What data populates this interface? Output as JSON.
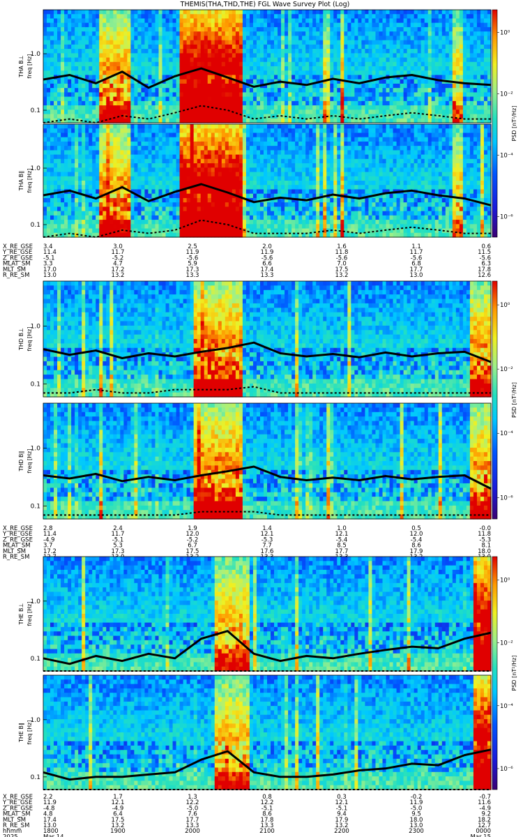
{
  "title": "THEMIS(THA,THD,THE) FGL Wave Survey Plot (Log)",
  "colors": {
    "colormap": [
      "#3a0072",
      "#1a1adb",
      "#0055ff",
      "#00c8ff",
      "#22e0c0",
      "#9cf08a",
      "#f0f020",
      "#ff9a00",
      "#e00000"
    ],
    "trace": "#000000"
  },
  "colorbar": {
    "label": "PSD [nT²/Hz]",
    "ticks": [
      "10⁰",
      "10⁻²",
      "10⁻⁴",
      "10⁻⁶"
    ]
  },
  "freq_ticks": [
    "1.0",
    "0.1"
  ],
  "eph_labels": [
    "X_RE_GSE",
    "Y_RE_GSE",
    "Z_RE_GSE",
    "MLAT_SM",
    "MLT_SM",
    "R_RE_SM"
  ],
  "time_row_labels": [
    "hhmm",
    "2025"
  ],
  "chart_data": [
    {
      "type": "heatmap",
      "probe": "THA",
      "panels": [
        {
          "ylabel": "THA B⊥",
          "unit": "freq [Hz]",
          "traces": {
            "f_peak": [
              0.35,
              0.42,
              0.3,
              0.48,
              0.25,
              0.4,
              0.55,
              0.38,
              0.26,
              0.32,
              0.28,
              0.36,
              0.3,
              0.38,
              0.42,
              0.34,
              0.3,
              0.28
            ],
            "f_low": [
              0.06,
              0.07,
              0.06,
              0.08,
              0.07,
              0.09,
              0.12,
              0.1,
              0.07,
              0.08,
              0.07,
              0.08,
              0.07,
              0.08,
              0.09,
              0.08,
              0.07,
              0.07
            ]
          }
        },
        {
          "ylabel": "THA B∥",
          "unit": "freq [Hz]",
          "traces": {
            "f_peak": [
              0.33,
              0.4,
              0.29,
              0.46,
              0.26,
              0.38,
              0.52,
              0.37,
              0.25,
              0.3,
              0.27,
              0.34,
              0.29,
              0.36,
              0.4,
              0.33,
              0.29,
              0.22
            ],
            "f_low": [
              0.06,
              0.07,
              0.06,
              0.08,
              0.07,
              0.08,
              0.12,
              0.1,
              0.07,
              0.07,
              0.07,
              0.08,
              0.07,
              0.08,
              0.09,
              0.08,
              0.07,
              0.07
            ]
          }
        }
      ],
      "ephemeris": [
        [
          "3.4",
          "3.0",
          "2.5",
          "2.0",
          "1.6",
          "1.1",
          "0.6"
        ],
        [
          "11.4",
          "11.7",
          "11.9",
          "11.9",
          "11.8",
          "11.7",
          "11.5"
        ],
        [
          "-5.1",
          "-5.2",
          "-5.6",
          "-5.6",
          "-5.6",
          "-5.6",
          "-5.6"
        ],
        [
          "3.3",
          "4.7",
          "5.9",
          "6.6",
          "7.0",
          "6.8",
          "6.3"
        ],
        [
          "17.0",
          "17.2",
          "17.3",
          "17.4",
          "17.5",
          "17.7",
          "17.8"
        ],
        [
          "13.0",
          "13.2",
          "13.3",
          "13.3",
          "13.2",
          "13.0",
          "12.6"
        ]
      ]
    },
    {
      "type": "heatmap",
      "probe": "THD",
      "panels": [
        {
          "ylabel": "THD B⊥",
          "unit": "freq [Hz]",
          "traces": {
            "f_peak": [
              0.4,
              0.32,
              0.38,
              0.28,
              0.34,
              0.3,
              0.36,
              0.42,
              0.52,
              0.34,
              0.3,
              0.33,
              0.29,
              0.35,
              0.3,
              0.34,
              0.36,
              0.24
            ],
            "f_low": [
              0.07,
              0.07,
              0.08,
              0.07,
              0.07,
              0.08,
              0.08,
              0.08,
              0.09,
              0.07,
              0.07,
              0.07,
              0.07,
              0.07,
              0.07,
              0.07,
              0.07,
              0.07
            ]
          }
        },
        {
          "ylabel": "THD B∥",
          "unit": "freq [Hz]",
          "traces": {
            "f_peak": [
              0.34,
              0.3,
              0.36,
              0.27,
              0.32,
              0.28,
              0.34,
              0.4,
              0.48,
              0.32,
              0.28,
              0.31,
              0.28,
              0.33,
              0.29,
              0.32,
              0.34,
              0.2
            ],
            "f_low": [
              0.07,
              0.07,
              0.07,
              0.07,
              0.07,
              0.07,
              0.08,
              0.08,
              0.08,
              0.07,
              0.07,
              0.07,
              0.07,
              0.07,
              0.07,
              0.07,
              0.07,
              0.07
            ]
          }
        }
      ],
      "ephemeris": [
        [
          "2.8",
          "2.4",
          "1.9",
          "1.4",
          "1.0",
          "0.5",
          "-0.0"
        ],
        [
          "11.4",
          "11.7",
          "12.0",
          "12.1",
          "12.1",
          "12.0",
          "11.8"
        ],
        [
          "-4.9",
          "-5.1",
          "-5.2",
          "-5.3",
          "-5.4",
          "-5.4",
          "-5.3"
        ],
        [
          "3.7",
          "5.3",
          "6.7",
          "7.7",
          "8.5",
          "8.6",
          "8.1"
        ],
        [
          "17.2",
          "17.3",
          "17.5",
          "17.6",
          "17.7",
          "17.9",
          "18.0"
        ],
        [
          "12.7",
          "13.0",
          "13.2",
          "13.3",
          "13.3",
          "13.2",
          "13.0"
        ]
      ]
    },
    {
      "type": "heatmap",
      "probe": "THE",
      "panels": [
        {
          "ylabel": "THE B⊥",
          "unit": "freq [Hz]",
          "traces": {
            "f_peak": [
              0.1,
              0.08,
              0.11,
              0.09,
              0.12,
              0.1,
              0.22,
              0.3,
              0.12,
              0.09,
              0.11,
              0.1,
              0.12,
              0.14,
              0.16,
              0.15,
              0.22,
              0.28
            ],
            "f_low": [
              0.06,
              0.06,
              0.06,
              0.06,
              0.06,
              0.06,
              0.06,
              0.06,
              0.06,
              0.06,
              0.06,
              0.06,
              0.06,
              0.06,
              0.06,
              0.06,
              0.06,
              0.06
            ]
          }
        },
        {
          "ylabel": "THE B∥",
          "unit": "freq [Hz]",
          "traces": {
            "f_peak": [
              0.12,
              0.09,
              0.1,
              0.1,
              0.11,
              0.12,
              0.2,
              0.28,
              0.12,
              0.1,
              0.1,
              0.11,
              0.13,
              0.14,
              0.17,
              0.16,
              0.24,
              0.3
            ],
            "f_low": [
              0.06,
              0.06,
              0.06,
              0.06,
              0.06,
              0.06,
              0.06,
              0.06,
              0.06,
              0.06,
              0.06,
              0.06,
              0.06,
              0.06,
              0.06,
              0.06,
              0.06,
              0.06
            ]
          }
        }
      ],
      "ephemeris": [
        [
          "2.2",
          "1.7",
          "1.3",
          "0.8",
          "0.3",
          "-0.2",
          "-0.7"
        ],
        [
          "11.9",
          "12.1",
          "12.2",
          "12.2",
          "12.1",
          "11.9",
          "11.6"
        ],
        [
          "-4.8",
          "-4.9",
          "-5.0",
          "-5.1",
          "-5.1",
          "-5.0",
          "-4.9"
        ],
        [
          "4.8",
          "6.4",
          "7.6",
          "8.6",
          "9.4",
          "9.5",
          "9.2"
        ],
        [
          "17.4",
          "17.5",
          "17.7",
          "17.8",
          "17.9",
          "18.0",
          "18.2"
        ],
        [
          "13.0",
          "13.2",
          "13.3",
          "13.3",
          "13.2",
          "13.0",
          "12.7"
        ]
      ],
      "time_labels": [
        "1800",
        "1900",
        "2000",
        "2100",
        "2200",
        "2300",
        "0000"
      ],
      "date_labels": [
        "Mar 14",
        "",
        "",
        "",
        "",
        "",
        "Mar 15"
      ]
    }
  ]
}
